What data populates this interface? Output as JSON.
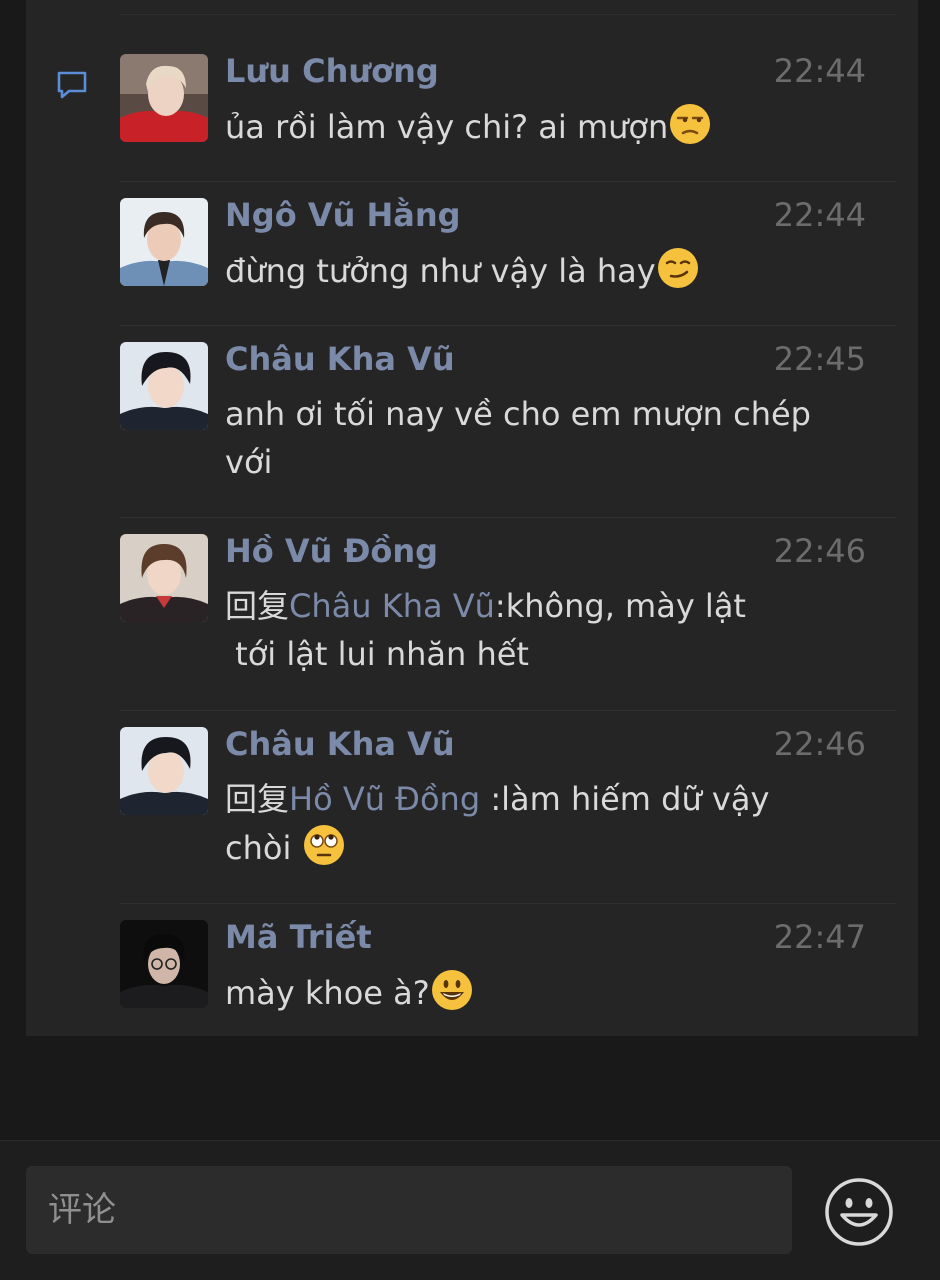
{
  "comments": [
    {
      "name": "Lưu Chương",
      "time": "22:44",
      "text": "ủa rồi làm vậy chi? ai mượn",
      "emoji": "unamused-face-icon"
    },
    {
      "name": "Ngô Vũ Hằng",
      "time": "22:44",
      "text": "đừng tưởng như vậy là hay",
      "emoji": "smirking-face-icon"
    },
    {
      "name": "Châu Kha Vũ",
      "time": "22:45",
      "text_line1": "anh ơi tối nay về cho em mượn chép",
      "text_line2": "với"
    },
    {
      "name": "Hồ Vũ Đồng",
      "time": "22:46",
      "reply_prefix": "回复",
      "reply_to": "Châu Kha Vũ",
      "text_line1": ":không, mày lật",
      "text_line2": " tới lật lui nhăn hết"
    },
    {
      "name": "Châu Kha Vũ",
      "time": "22:46",
      "reply_prefix": "回复",
      "reply_to": "Hồ Vũ Đồng ",
      "text_line1": ":làm hiếm dữ vậy",
      "text_line2": "chòi ",
      "emoji": "face-with-rolling-eyes-icon"
    },
    {
      "name": "Mã Triết",
      "time": "22:47",
      "text": "mày khoe à?",
      "emoji": "grinning-face-icon"
    }
  ],
  "input": {
    "placeholder": "评论"
  },
  "colors": {
    "background": "#191919",
    "panel": "#252525",
    "name": "#7c8aa9",
    "text": "#d9d9d9",
    "time": "#6c6c6c",
    "comment_icon": "#5b8ed6"
  },
  "icons": {
    "comment": "comment-bubble-icon",
    "emoji_button": "smiley-face-icon"
  }
}
